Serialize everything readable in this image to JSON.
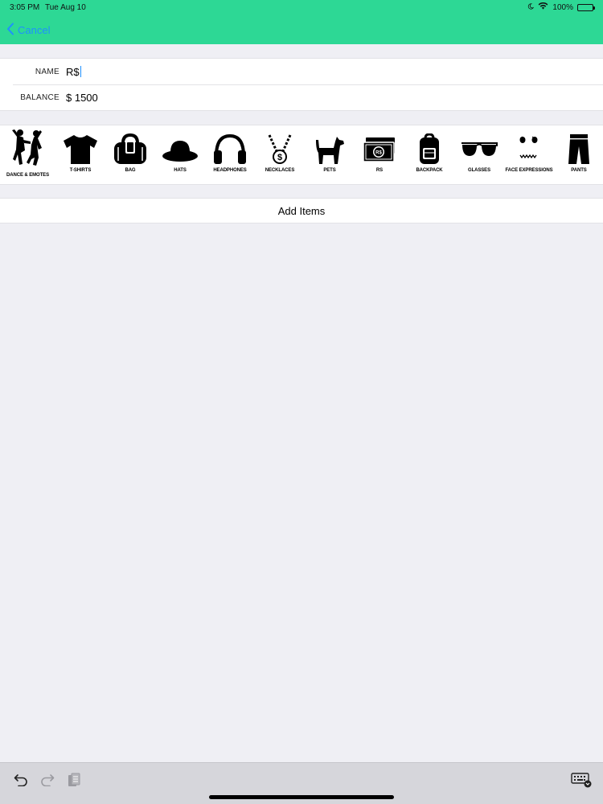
{
  "status_bar": {
    "time": "3:05 PM",
    "date": "Tue Aug 10",
    "battery": "100%"
  },
  "nav": {
    "cancel_label": "Cancel"
  },
  "form": {
    "name_label": "NAME",
    "name_value": "R$",
    "balance_label": "BALANCE",
    "balance_value": "$ 1500"
  },
  "categories": [
    {
      "label": "DANCE & EMOTES",
      "icon": "dance-icon"
    },
    {
      "label": "T-SHIRTS",
      "icon": "tshirt-icon"
    },
    {
      "label": "BAG",
      "icon": "bag-icon"
    },
    {
      "label": "HATS",
      "icon": "hat-icon"
    },
    {
      "label": "HEADPHONES",
      "icon": "headphones-icon"
    },
    {
      "label": "NECKLACES",
      "icon": "necklace-icon"
    },
    {
      "label": "PETS",
      "icon": "pet-icon"
    },
    {
      "label": "RS",
      "icon": "money-icon"
    },
    {
      "label": "BACKPACK",
      "icon": "backpack-icon"
    },
    {
      "label": "GLASSES",
      "icon": "sunglasses-icon"
    },
    {
      "label": "FACE EXPRESSIONS",
      "icon": "face-icon"
    },
    {
      "label": "PANTS",
      "icon": "pants-icon"
    }
  ],
  "add_items_label": "Add Items",
  "colors": {
    "header": "#2dd895",
    "accent": "#1e90ff",
    "background": "#efeff4"
  }
}
